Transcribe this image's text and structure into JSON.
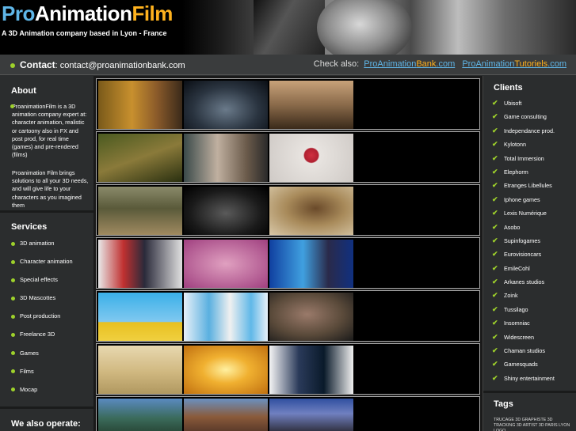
{
  "header": {
    "logo_pro": "Pro",
    "logo_animation": "Animation",
    "logo_film": "Film",
    "tagline": "A 3D Animation company based in Lyon - France"
  },
  "contact_bar": {
    "contact_label": "Contact",
    "contact_email": ": contact@proanimationbank.com",
    "check_also": "Check also:",
    "link1_a": "ProAnimation",
    "link1_b": "Bank",
    "link1_c": ".com",
    "link2_a": "ProAnimation",
    "link2_b": "Tutoriels",
    "link2_c": ".com"
  },
  "about": {
    "title": "About",
    "paragraph1": "ProanimationFilm is a 3D animation company expert at: character animation, realistic or cartoony also in FX and post prod, for real time (games) and pre-rendered (films)",
    "paragraph2": "Proanimation Film brings solutions to all your 3D needs, and will give life to your characters as you imagined them"
  },
  "services": {
    "title": "Services",
    "items": [
      "3D animation",
      "Character animation",
      "Special effects",
      "3D Mascottes",
      "Post production",
      "Freelance 3D",
      "Games",
      "Films",
      "Mocap"
    ]
  },
  "operate": {
    "title": "We also operate:"
  },
  "clients": {
    "title": "Clients",
    "items": [
      "Ubisoft",
      "Game consulting",
      "Independance prod.",
      "Kylotonn",
      "Total Immersion",
      "Elephorm",
      "Etranges Libellules",
      "Iphone games",
      "Lexis Numérique",
      "Asobo",
      "Supinfogames",
      "Eurovisioncars",
      "EmileCohl",
      "Arkanes studios",
      "Zoink",
      "Tussilago",
      "Insomniac",
      "Widescreen",
      "Chaman studios",
      "Gamesquads",
      "Shiny entertainment"
    ]
  },
  "tags": {
    "title": "Tags",
    "text": "TRUCAGE 3D GRAPHISTE 3D TRACKING 3D ARTIST 3D PARIS LYON LOGO"
  },
  "colors": {
    "accent_blue": "#5fb6e8",
    "accent_orange": "#ffb21e",
    "bullet_green": "#9ed12b",
    "background": "#2b2d2e"
  }
}
